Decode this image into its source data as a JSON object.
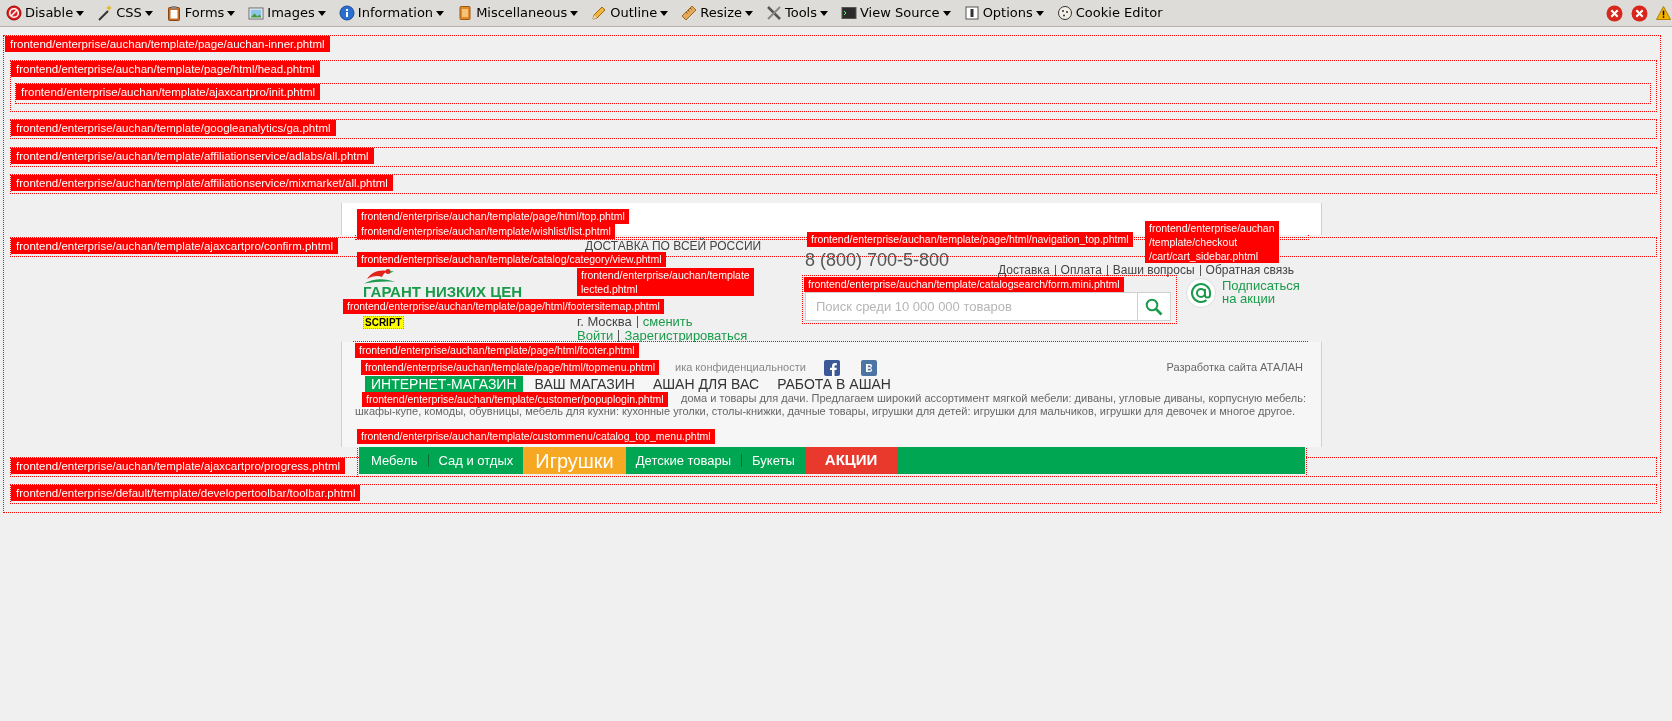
{
  "toolbar": {
    "menus": [
      {
        "label": "Disable",
        "dropdown": true
      },
      {
        "label": "CSS",
        "dropdown": true
      },
      {
        "label": "Forms",
        "dropdown": true
      },
      {
        "label": "Images",
        "dropdown": true
      },
      {
        "label": "Information",
        "dropdown": true
      },
      {
        "label": "Miscellaneous",
        "dropdown": true
      },
      {
        "label": "Outline",
        "dropdown": true
      },
      {
        "label": "Resize",
        "dropdown": true
      },
      {
        "label": "Tools",
        "dropdown": true
      },
      {
        "label": "View Source",
        "dropdown": true
      },
      {
        "label": "Options",
        "dropdown": true
      },
      {
        "label": "Cookie Editor",
        "dropdown": false
      }
    ]
  },
  "template_hints": {
    "path": "frontend/enterprise/auchan/template/page/auchan-inner.phtml",
    "children": [
      {
        "path": "frontend/enterprise/auchan/template/page/html/head.phtml",
        "children": [
          {
            "path": "frontend/enterprise/auchan/template/ajaxcartpro/init.phtml"
          }
        ]
      },
      {
        "path": "frontend/enterprise/auchan/template/googleanalytics/ga.phtml"
      },
      {
        "path": "frontend/enterprise/auchan/template/affiliationservice/adlabs/all.phtml"
      },
      {
        "path": "frontend/enterprise/auchan/template/affiliationservice/mixmarket/all.phtml"
      },
      {
        "path": "frontend/enterprise/auchan/template/ajaxcartpro/confirm.phtml"
      },
      {
        "path": "frontend/enterprise/auchan/template/ajaxcartpro/progress.phtml"
      },
      {
        "path": "frontend/enterprise/default/template/developertoolbar/toolbar.phtml"
      }
    ]
  },
  "site": {
    "header": {
      "delivery": "ДОСТАВКА ПО ВСЕЙ РОССИИ",
      "slogan": "ГАРАНТ НИЗКИХ ЦЕН",
      "script_marker": "SCRIPT",
      "city": "г. Москва",
      "change_city": "сменить",
      "login": "Войти",
      "register": "Зарегистрироваться",
      "phone": "8 (800) 700-5-800",
      "info_links": [
        "Доставка",
        "Оплата",
        "Ваши вопросы",
        "Обратная связь"
      ],
      "search": {
        "placeholder": "Поиск среди 10 000 000 товаров"
      },
      "subscribe": "Подписаться на акции"
    },
    "footer": {
      "privacy": "ика конфиденциальности",
      "developer": "Разработка сайта АТАЛАН",
      "top_menu": [
        {
          "label": "ИНТЕРНЕТ-МАГАЗИН",
          "selected": true
        },
        {
          "label": "ВАШ МАГАЗИН",
          "selected": false
        },
        {
          "label": "АШАН ДЛЯ ВАС",
          "selected": false
        },
        {
          "label": "РАБОТА В АШАН",
          "selected": false
        }
      ],
      "description": [
        "дома и товары для дачи. Предлагаем широкий ассортимент мягкой мебели: диваны, угловые диваны, корпусную мебель:",
        "шкафы-купе, комоды, обувницы, мебель для кухни: кухонные уголки, столы-книжки, дачные товары, игрушки для детей: игрушки для мальчиков, игрушки для девочек и многое другое."
      ]
    },
    "catalog_menu": [
      {
        "label": "Мебель",
        "kind": "plain"
      },
      {
        "label": "Сад и отдых",
        "kind": "plain"
      },
      {
        "label": "Игрушки",
        "kind": "featured"
      },
      {
        "label": "Детские товары",
        "kind": "plain"
      },
      {
        "label": "Букеты",
        "kind": "plain"
      },
      {
        "label": "АКЦИИ",
        "kind": "sale"
      }
    ]
  },
  "overlay_hints": [
    {
      "lines": [
        "frontend/enterprise/auchan/template/page/html/top.phtml"
      ]
    },
    {
      "lines": [
        "frontend/enterprise/auchan/template/wishlist/list.phtml"
      ]
    },
    {
      "lines": [
        "frontend/enterprise/auchan/template/catalog/category/view.phtml"
      ]
    },
    {
      "lines": [
        "frontend/enterprise/auchan/template/page/html/footersitemap.phtml"
      ]
    },
    {
      "lines": [
        "frontend/enterprise/auchan/template",
        "lected.phtml"
      ]
    },
    {
      "lines": [
        "frontend/enterprise/auchan/template/page/html/navigation_top.phtml"
      ]
    },
    {
      "lines": [
        "frontend/enterprise/auchan",
        "/template/checkout",
        "/cart/cart_sidebar.phtml"
      ]
    },
    {
      "lines": [
        "frontend/enterprise/auchan/template/catalogsearch/form.mini.phtml"
      ]
    },
    {
      "lines": [
        "frontend/enterprise/auchan/template/page/html/footer.phtml"
      ]
    },
    {
      "lines": [
        "frontend/enterprise/auchan/template/page/html/topmenu.phtml"
      ]
    },
    {
      "lines": [
        "frontend/enterprise/auchan/template/customer/popuplogin.phtml"
      ]
    },
    {
      "lines": [
        "frontend/enterprise/auchan/template/custommenu/catalog_top_menu.phtml"
      ]
    }
  ]
}
